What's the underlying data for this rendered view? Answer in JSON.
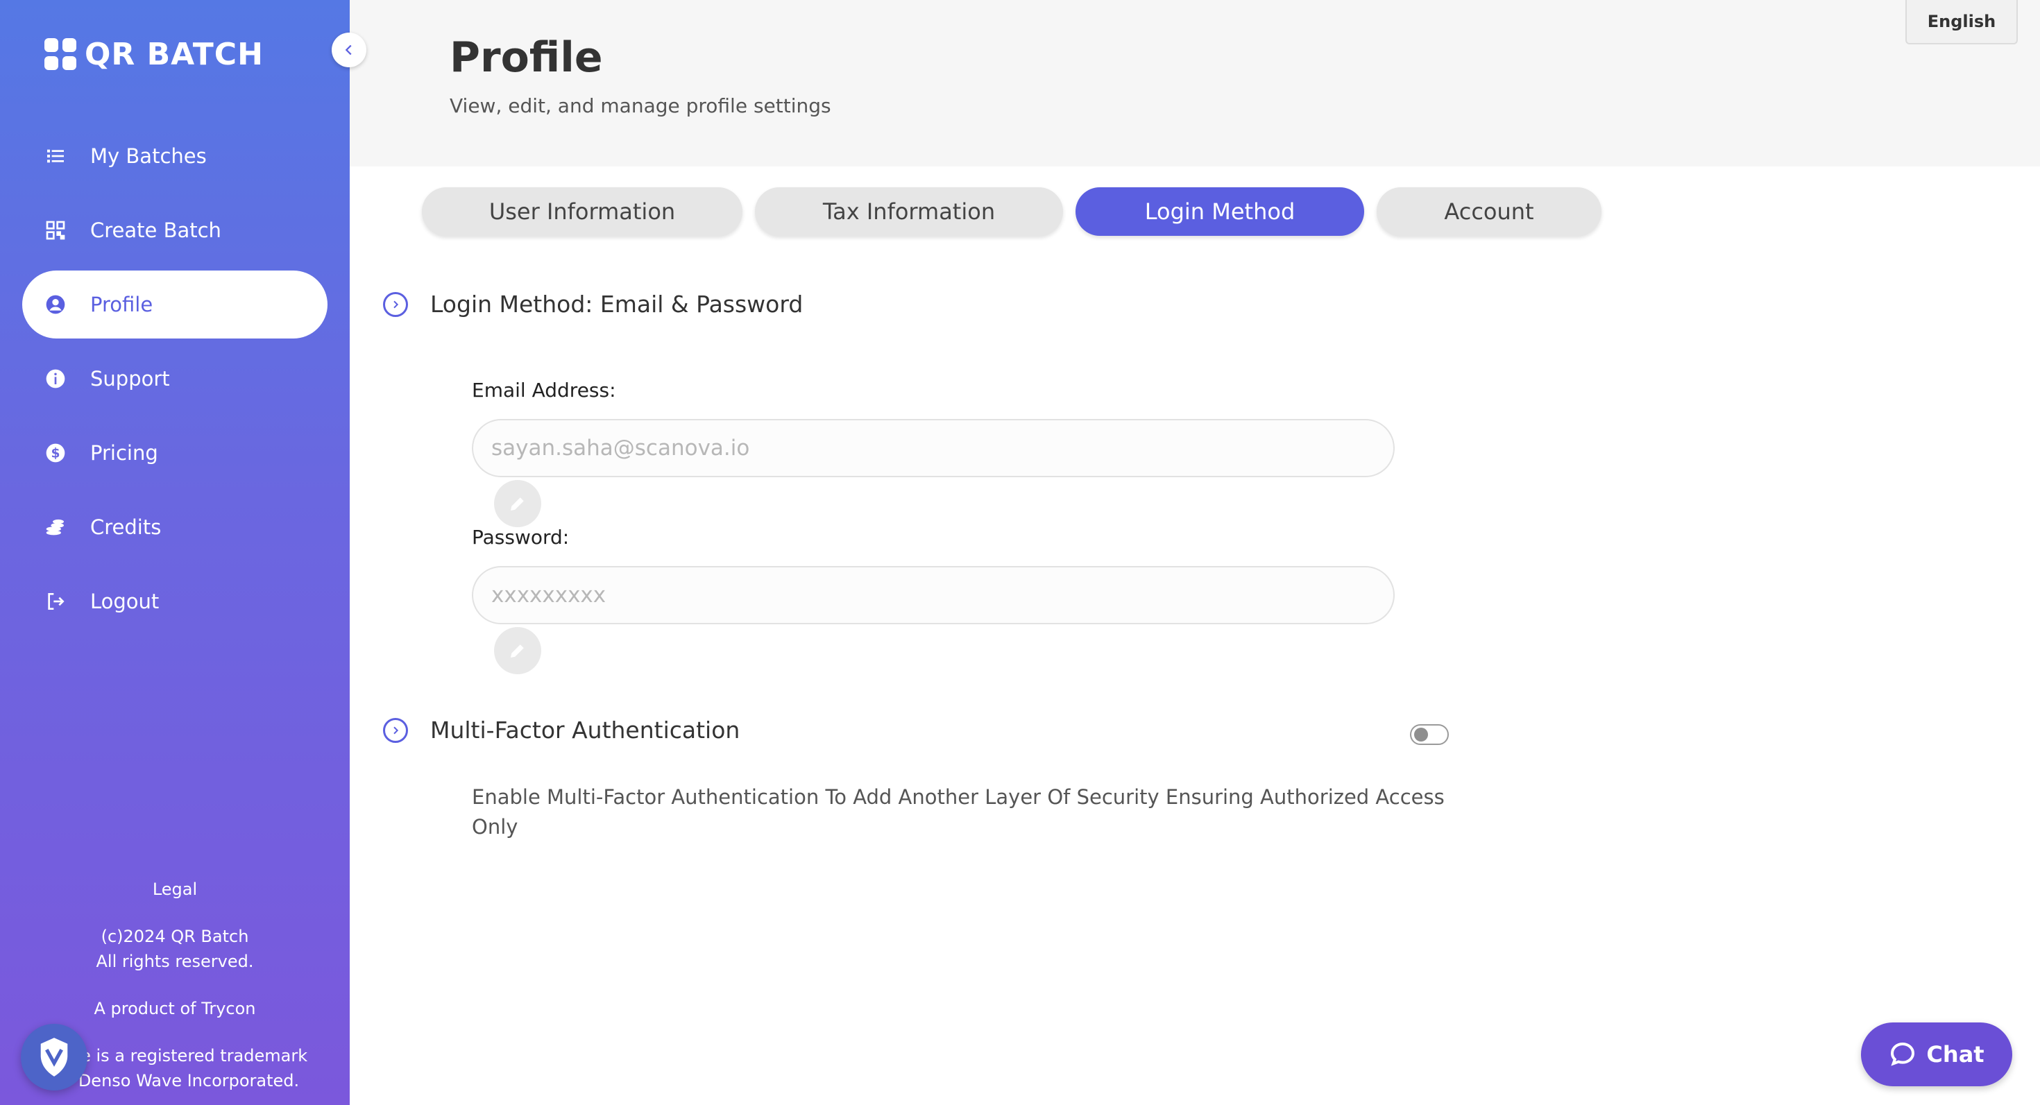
{
  "app": {
    "brand": "QR BATCH"
  },
  "sidebar": {
    "items": [
      {
        "label": "My Batches",
        "icon": "list-icon"
      },
      {
        "label": "Create Batch",
        "icon": "qr-code-icon"
      },
      {
        "label": "Profile",
        "icon": "user-circle-icon",
        "active": true
      },
      {
        "label": "Support",
        "icon": "info-icon"
      },
      {
        "label": "Pricing",
        "icon": "dollar-icon"
      },
      {
        "label": "Credits",
        "icon": "coins-icon"
      },
      {
        "label": "Logout",
        "icon": "logout-icon"
      }
    ],
    "footer": {
      "legal": "Legal",
      "copyright_line1": "(c)2024 QR Batch",
      "copyright_line2": "All rights reserved.",
      "product": "A product of Trycon",
      "trademark_line1": "de is a registered trademark",
      "trademark_line2": "Denso Wave Incorporated."
    }
  },
  "header": {
    "title": "Profile",
    "subtitle": "View, edit, and manage profile settings",
    "language": "English"
  },
  "tabs": [
    {
      "label": "User Information",
      "active": false
    },
    {
      "label": "Tax Information",
      "active": false
    },
    {
      "label": "Login Method",
      "active": true
    },
    {
      "label": "Account",
      "active": false
    }
  ],
  "login_section": {
    "title": "Login Method: Email & Password",
    "email_label": "Email Address:",
    "email_placeholder": "sayan.saha@scanova.io",
    "password_label": "Password:",
    "password_placeholder": "xxxxxxxxx"
  },
  "mfa_section": {
    "title": "Multi-Factor Authentication",
    "enabled": false,
    "description": "Enable Multi-Factor Authentication To Add Another Layer Of Security Ensuring Authorized Access Only"
  },
  "chat": {
    "label": "Chat"
  },
  "colors": {
    "accent": "#5b5fe0",
    "sidebar_top": "#5578e4",
    "sidebar_bottom": "#7b58dc",
    "chat": "#6a4fd6"
  }
}
